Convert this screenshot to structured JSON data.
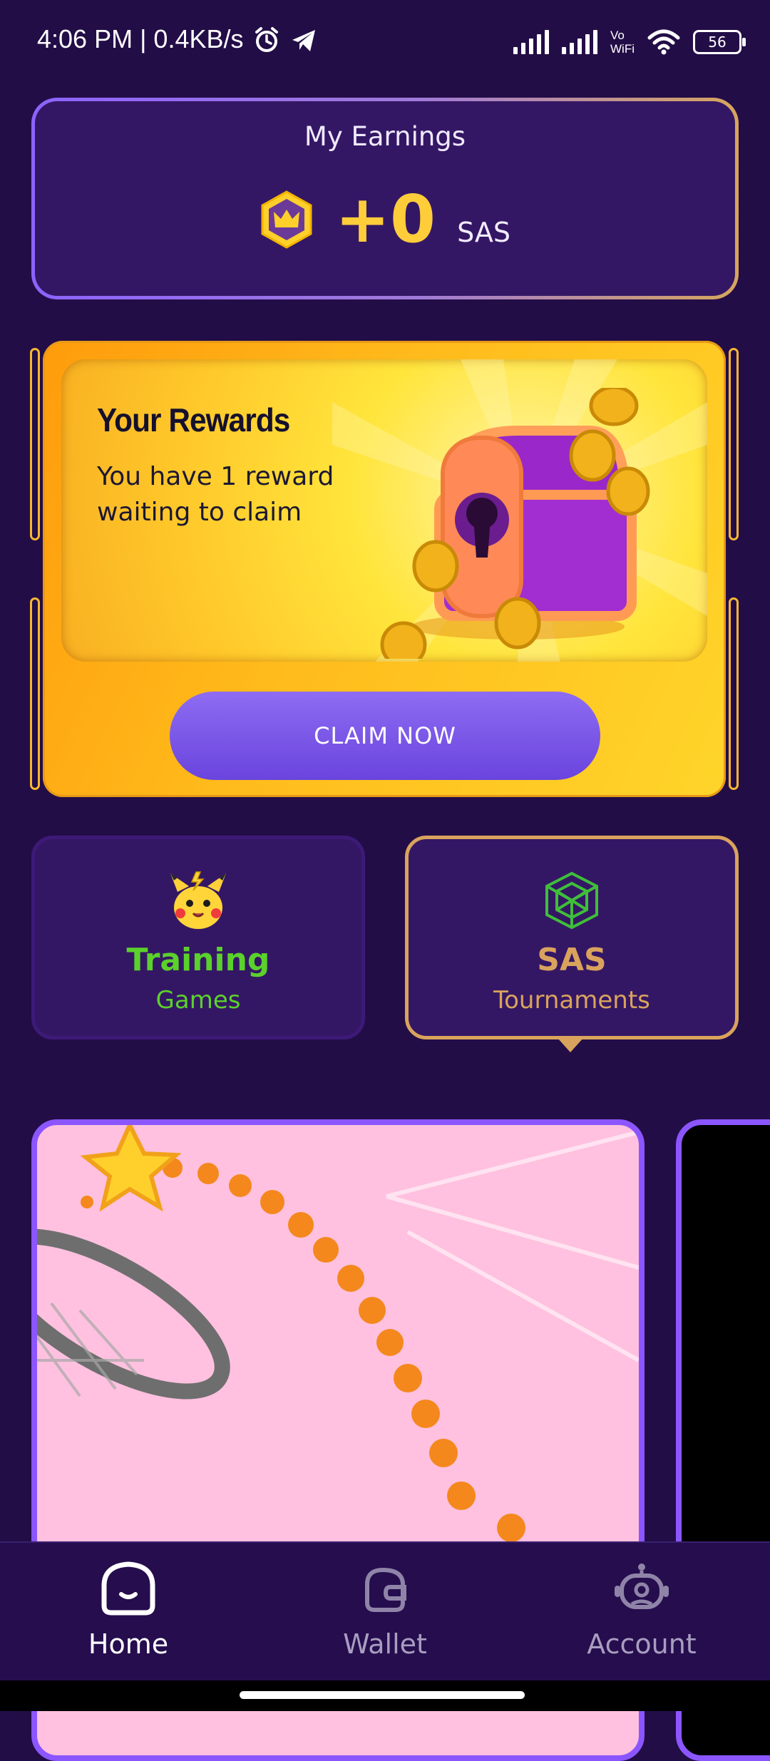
{
  "status_bar": {
    "time": "4:06 PM | 0.4KB/s",
    "network_label": "Vo\nWiFi",
    "battery": "56"
  },
  "earnings": {
    "title": "My Earnings",
    "value": "+0",
    "unit": "SAS"
  },
  "rewards": {
    "title": "Your Rewards",
    "description": "You have 1 reward waiting to claim",
    "claim_label": "CLAIM NOW"
  },
  "modes": [
    {
      "title": "Training",
      "subtitle": "Games",
      "color": "#5bd12c",
      "selected": false
    },
    {
      "title": "SAS",
      "subtitle": "Tournaments",
      "color": "#d9a35d",
      "selected": true
    }
  ],
  "nav": {
    "items": [
      {
        "label": "Home",
        "icon": "home-smile-icon",
        "active": true
      },
      {
        "label": "Wallet",
        "icon": "wallet-icon",
        "active": false
      },
      {
        "label": "Account",
        "icon": "robot-account-icon",
        "active": false
      }
    ]
  },
  "colors": {
    "background": "#230d47",
    "card": "#341764",
    "accent_purple": "#8b56ff",
    "gold": "#ffcd3a",
    "claim_button": "#6a44de"
  }
}
